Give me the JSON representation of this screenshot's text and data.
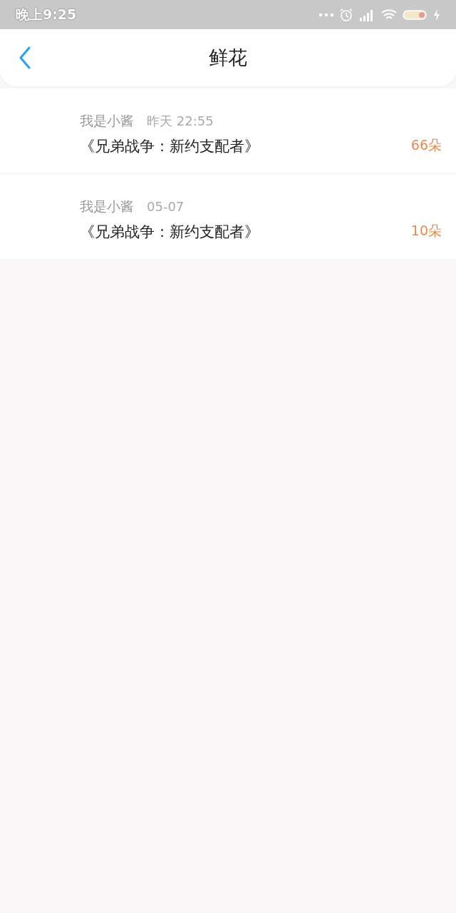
{
  "status_bar": {
    "time": "晚上9:25"
  },
  "header": {
    "title": "鲜花"
  },
  "records": [
    {
      "user": "我是小酱",
      "time": "昨天 22:55",
      "title": "《兄弟战争：新约支配者》",
      "amount": "66朵"
    },
    {
      "user": "我是小酱",
      "time": "05-07",
      "title": "《兄弟战争：新约支配者》",
      "amount": "10朵"
    }
  ]
}
